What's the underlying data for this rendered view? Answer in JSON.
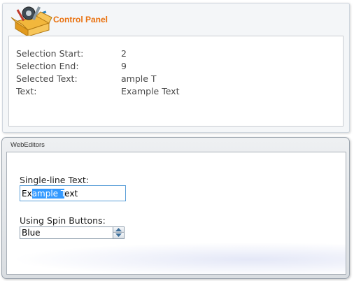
{
  "control_panel": {
    "title": "Control Panel",
    "rows": [
      {
        "label": "Selection Start:",
        "value": "2"
      },
      {
        "label": "Selection End:",
        "value": "9"
      },
      {
        "label": "Selected Text:",
        "value": "ample T"
      },
      {
        "label": "Text:",
        "value": "Example Text"
      }
    ]
  },
  "web_editors": {
    "header": "WebEditors",
    "single_line": {
      "label": "Single-line Text:",
      "value_before": "Ex",
      "value_selected": "ample T",
      "value_after": "ext"
    },
    "spin": {
      "label": "Using Spin Buttons:",
      "value": "Blue"
    }
  },
  "colors": {
    "title_orange": "#e9700d",
    "selection_blue": "#3399ff",
    "focus_border": "#5b9fd8"
  }
}
